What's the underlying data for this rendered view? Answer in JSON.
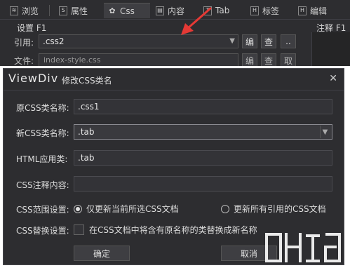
{
  "tabs": [
    {
      "icon": "layers-icon",
      "glyph": "≋",
      "label": "浏览",
      "active": false
    },
    {
      "icon": "s-icon",
      "glyph": "S",
      "label": "属性",
      "active": false
    },
    {
      "icon": "gear-icon",
      "glyph": "✿",
      "label": "Css",
      "active": true
    },
    {
      "icon": "content-icon",
      "glyph": "▤",
      "label": "内容",
      "active": false
    },
    {
      "icon": "t-icon",
      "glyph": "T",
      "label": "Tab",
      "active": false
    },
    {
      "icon": "h-icon",
      "glyph": "H",
      "label": "标签",
      "active": false
    },
    {
      "icon": "h-icon",
      "glyph": "H",
      "label": "编辑",
      "active": false
    }
  ],
  "settings": {
    "title": "设置 F1",
    "ref_label": "引用:",
    "ref_value": ".css2",
    "edit_btn": "编",
    "find_btn": "查",
    "more_btn": "..",
    "file_label": "文件:",
    "file_value": "index-style.css",
    "file_btn1": "编",
    "file_btn2": "查",
    "file_btn3": "取",
    "note_title": "注释 F1"
  },
  "dialog": {
    "title": "ViewDiv",
    "subtitle": "修改CSS类名",
    "close": "✕",
    "orig_label": "原CSS类名称:",
    "orig_value": ".css1",
    "new_label": "新CSS类名称:",
    "new_value": ".tab",
    "html_label": "HTML应用类:",
    "html_value": ".tab",
    "comment_label": "CSS注释内容:",
    "comment_value": "",
    "scope_label": "CSS范围设置:",
    "scope_opt1": "仅更新当前所选CSS文档",
    "scope_opt2": "更新所有引用的CSS文档",
    "scope_selected": 1,
    "replace_label": "CSS替换设置:",
    "replace_text": "在CSS文档中将含有原名称的类替换成新名称",
    "replace_checked": false,
    "ok": "确定",
    "cancel": "取消"
  },
  "colors": {
    "background": "#2d2d30",
    "input": "#333337",
    "text": "#dcdcdc",
    "arrow": "#e53935"
  }
}
